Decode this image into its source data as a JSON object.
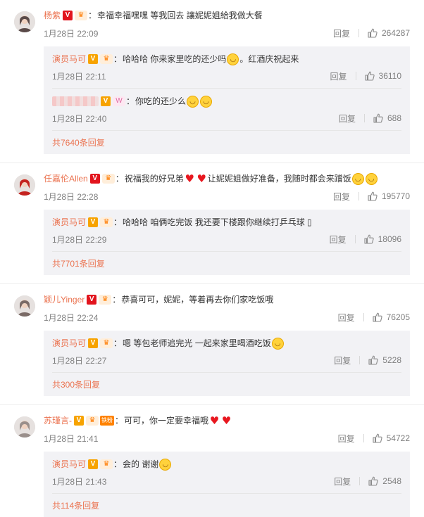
{
  "threads": [
    {
      "avatar_color": "#5a4a48",
      "user": "杨紫",
      "badges": [
        "V-red",
        "crown"
      ],
      "text": "幸福幸福嘿嘿 等我回去 讓妮妮姐給我做大餐",
      "time": "1月28日 22:09",
      "reply_label": "回复",
      "likes": "264287",
      "replies": [
        {
          "user": "演员马可",
          "badges": [
            "V",
            "crown"
          ],
          "text": "哈哈哈 你来家里吃的还少吗",
          "emoji_mid": "laugh",
          "text_after": "。红酒庆祝起来",
          "time": "1月28日 22:11",
          "reply_label": "回复",
          "likes": "36110"
        },
        {
          "user_blurred": true,
          "badges": [
            "V",
            "W"
          ],
          "text": "你吃的还少么",
          "emojis_after": [
            "yum",
            "yum"
          ],
          "time": "1月28日 22:40",
          "reply_label": "回复",
          "likes": "688"
        }
      ],
      "more": "共7640条回复"
    },
    {
      "avatar_color": "#c4221f",
      "user": "任嘉伦Allen",
      "badges": [
        "V-red",
        "crown"
      ],
      "text": "祝福我的好兄弟",
      "emojis_mid": [
        "heart",
        "heart"
      ],
      "text_after": "让妮妮姐做好准备，我随时都会来蹭饭",
      "emojis_after": [
        "grin",
        "grin"
      ],
      "time": "1月28日 22:28",
      "reply_label": "回复",
      "likes": "195770",
      "replies": [
        {
          "user": "演员马可",
          "badges": [
            "V",
            "crown"
          ],
          "text": "哈哈哈 咱俩吃完饭 我还要下楼跟你继续打乒乓球 ▯",
          "time": "1月28日 22:29",
          "reply_label": "回复",
          "likes": "18096"
        }
      ],
      "more": "共7701条回复"
    },
    {
      "avatar_color": "#7a6a66",
      "user": "颖儿Yinger",
      "badges": [
        "V-red",
        "crown"
      ],
      "text": "恭喜可可，妮妮，等着再去你们家吃饭哦",
      "time": "1月28日 22:24",
      "reply_label": "回复",
      "likes": "76205",
      "replies": [
        {
          "user": "演员马可",
          "badges": [
            "V",
            "crown"
          ],
          "text": "嗯 等包老师追完光 一起来家里喝酒吃饭",
          "emojis_after": [
            "grin"
          ],
          "time": "1月28日 22:27",
          "reply_label": "回复",
          "likes": "5228"
        }
      ],
      "more": "共300条回复"
    },
    {
      "avatar_color": "#9a8f8b",
      "user": "苏瑾言-",
      "badges": [
        "V",
        "crown-fan"
      ],
      "fan_label": "铁粉",
      "text": "可可，你一定要幸福哦",
      "emojis_after": [
        "heart",
        "heart"
      ],
      "time": "1月28日 21:41",
      "reply_label": "回复",
      "likes": "54722",
      "replies": [
        {
          "user": "演员马可",
          "badges": [
            "V",
            "crown"
          ],
          "text": "会的 谢谢",
          "emojis_after": [
            "smile"
          ],
          "time": "1月28日 21:43",
          "reply_label": "回复",
          "likes": "2548"
        }
      ],
      "more": "共114条回复"
    }
  ],
  "icons": {
    "like": "thumbs-up-icon",
    "verified": "v-badge-icon",
    "member": "crown-badge-icon"
  },
  "colors": {
    "username": "#eb7350",
    "meta": "#808080",
    "reply_bg": "#f2f2f5",
    "v_orange": "#f7a300",
    "v_red": "#e2141d"
  }
}
